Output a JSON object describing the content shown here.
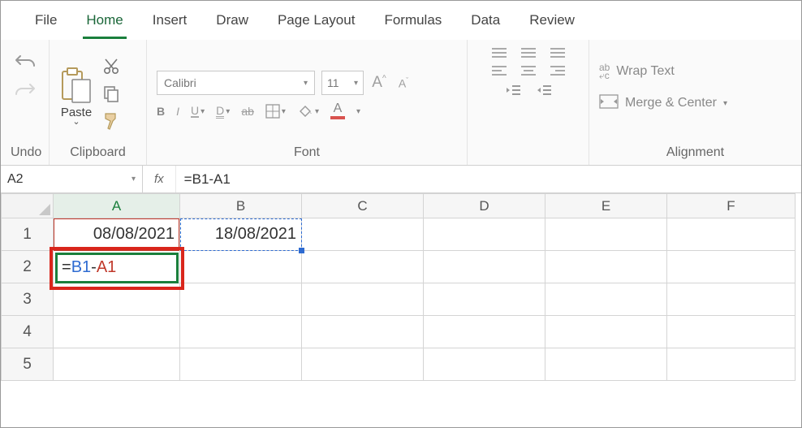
{
  "ribbon": {
    "tabs": [
      "File",
      "Home",
      "Insert",
      "Draw",
      "Page Layout",
      "Formulas",
      "Data",
      "Review"
    ],
    "active_tab_index": 1,
    "groups": {
      "undo": {
        "label": "Undo"
      },
      "clipboard": {
        "label": "Clipboard",
        "paste_label": "Paste"
      },
      "font": {
        "label": "Font",
        "font_name": "Calibri",
        "font_size": "11",
        "buttons": {
          "bold": "B",
          "italic": "I",
          "underline": "U",
          "double_underline": "D",
          "strike": "ab"
        }
      },
      "alignment": {
        "label": "Alignment",
        "wrap_text_label": "Wrap Text",
        "merge_center_label": "Merge & Center"
      }
    }
  },
  "formula_bar": {
    "name_box": "A2",
    "fx_label": "fx",
    "formula": "=B1-A1"
  },
  "grid": {
    "columns": [
      "A",
      "B",
      "C",
      "D",
      "E",
      "F"
    ],
    "row_count": 5,
    "cells": {
      "A1": "08/08/2021",
      "B1": "18/08/2021",
      "A2_display": {
        "eq": "=",
        "ref1": "B1",
        "op": "-",
        "ref2": "A1"
      }
    },
    "active_cell": "A2",
    "referenced_cells": [
      "A1",
      "B1"
    ]
  }
}
